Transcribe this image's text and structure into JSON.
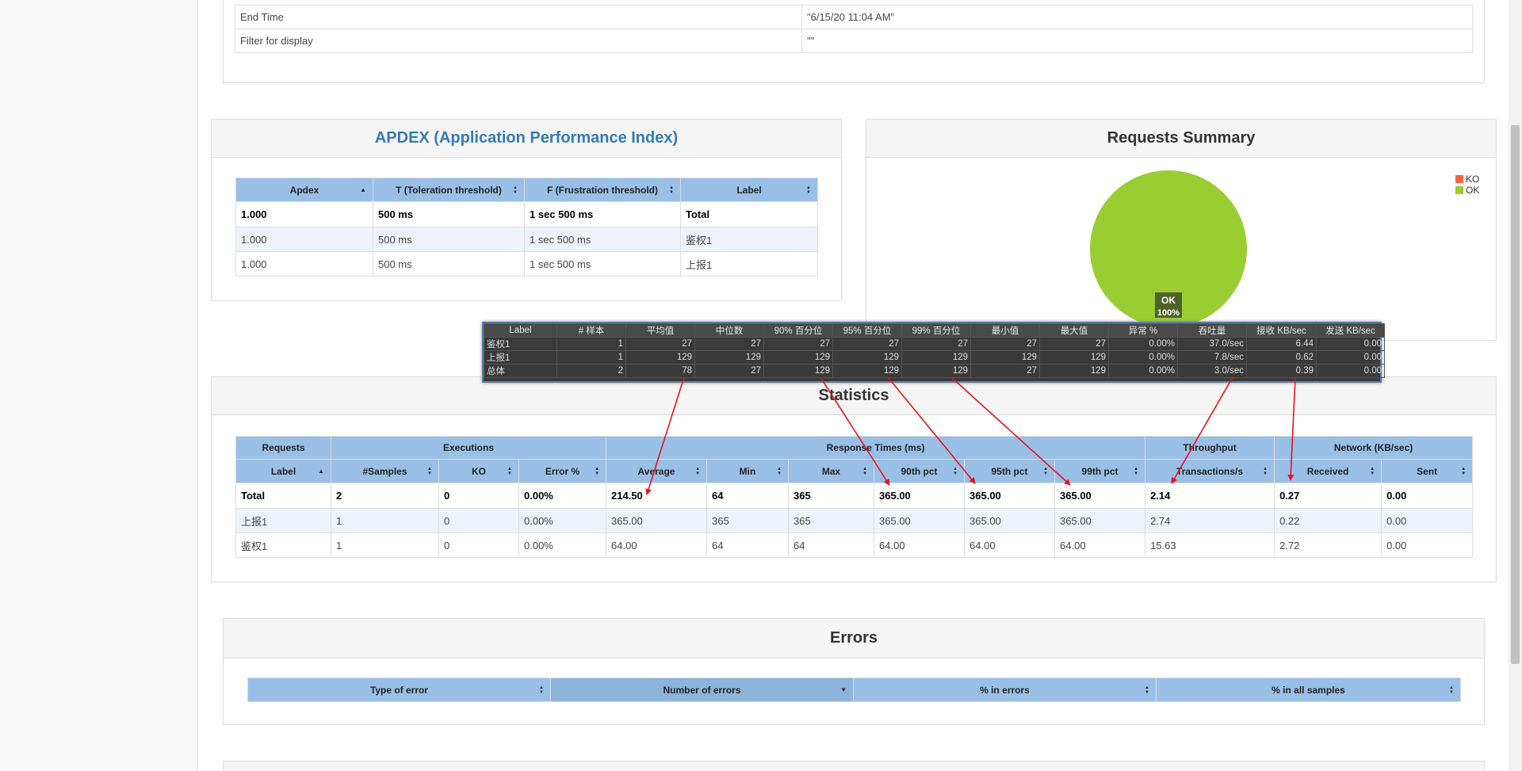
{
  "info_table": {
    "rows": [
      {
        "key": "End Time",
        "value": "\"6/15/20 11:04 AM\""
      },
      {
        "key": "Filter for display",
        "value": "\"\""
      }
    ]
  },
  "apdex": {
    "title": "APDEX (Application Performance Index)",
    "headers": [
      "Apdex",
      "T (Toleration threshold)",
      "F (Frustration threshold)",
      "Label"
    ],
    "rows": [
      [
        "1.000",
        "500 ms",
        "1 sec 500 ms",
        "Total"
      ],
      [
        "1.000",
        "500 ms",
        "1 sec 500 ms",
        "鉴权1"
      ],
      [
        "1.000",
        "500 ms",
        "1 sec 500 ms",
        "上报1"
      ]
    ]
  },
  "requests_summary": {
    "title": "Requests Summary",
    "legend": [
      {
        "label": "KO",
        "color": "#ff6347"
      },
      {
        "label": "OK",
        "color": "#9acd32"
      }
    ],
    "slice_label": "OK",
    "slice_pct": "100%"
  },
  "chart_data": {
    "type": "pie",
    "title": "Requests Summary",
    "categories": [
      "KO",
      "OK"
    ],
    "values": [
      0,
      100
    ],
    "colors": [
      "#ff6347",
      "#9acd32"
    ],
    "legend": "top-right"
  },
  "tooltip_table": {
    "headers": [
      "Label",
      "# 样本",
      "平均值",
      "中位数",
      "90% 百分位",
      "95% 百分位",
      "99% 百分位",
      "最小值",
      "最大值",
      "异常 %",
      "吞吐量",
      "接收 KB/sec",
      "发送 KB/sec"
    ],
    "rows": [
      [
        "鉴权1",
        "1",
        "27",
        "27",
        "27",
        "27",
        "27",
        "27",
        "27",
        "0.00%",
        "37.0/sec",
        "6.44",
        "0.00"
      ],
      [
        "上报1",
        "1",
        "129",
        "129",
        "129",
        "129",
        "129",
        "129",
        "129",
        "0.00%",
        "7.8/sec",
        "0.62",
        "0.00"
      ],
      [
        "总体",
        "2",
        "78",
        "27",
        "129",
        "129",
        "129",
        "27",
        "129",
        "0.00%",
        "3.0/sec",
        "0.39",
        "0.00"
      ]
    ]
  },
  "statistics": {
    "title": "Statistics",
    "group_headers": [
      "Requests",
      "Executions",
      "Response Times (ms)",
      "Throughput",
      "Network (KB/sec)"
    ],
    "headers": [
      "Label",
      "#Samples",
      "KO",
      "Error %",
      "Average",
      "Min",
      "Max",
      "90th pct",
      "95th pct",
      "99th pct",
      "Transactions/s",
      "Received",
      "Sent"
    ],
    "rows": [
      [
        "Total",
        "2",
        "0",
        "0.00%",
        "214.50",
        "64",
        "365",
        "365.00",
        "365.00",
        "365.00",
        "2.14",
        "0.27",
        "0.00"
      ],
      [
        "上报1",
        "1",
        "0",
        "0.00%",
        "365.00",
        "365",
        "365",
        "365.00",
        "365.00",
        "365.00",
        "2.74",
        "0.22",
        "0.00"
      ],
      [
        "鉴权1",
        "1",
        "0",
        "0.00%",
        "64.00",
        "64",
        "64",
        "64.00",
        "64.00",
        "64.00",
        "15.63",
        "2.72",
        "0.00"
      ]
    ]
  },
  "errors": {
    "title": "Errors",
    "headers": [
      "Type of error",
      "Number of errors",
      "% in errors",
      "% in all samples"
    ]
  }
}
